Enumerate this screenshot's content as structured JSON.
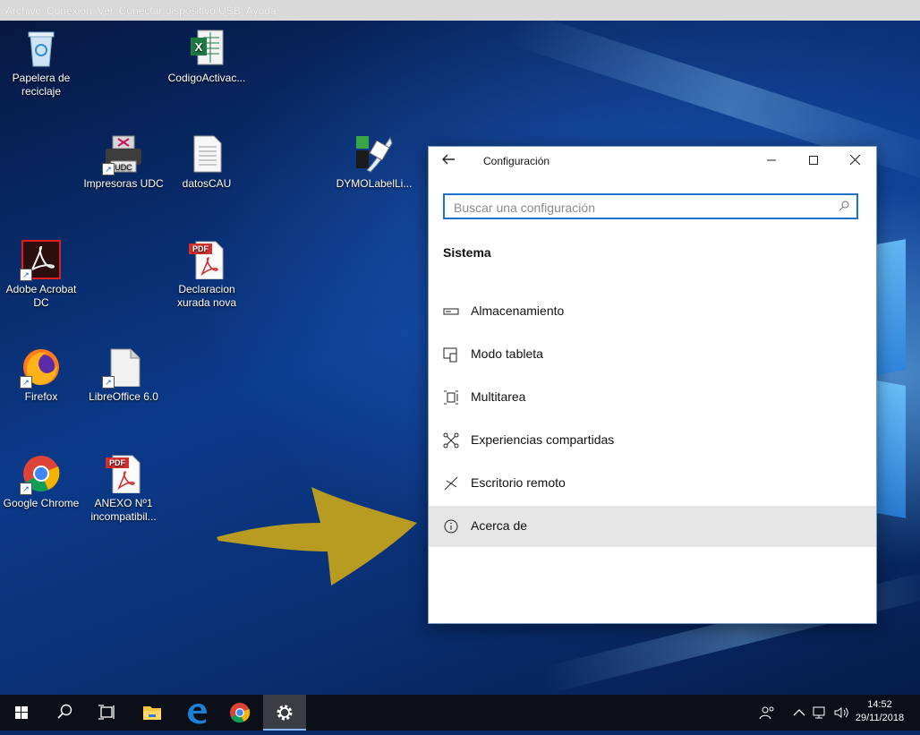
{
  "menubar": {
    "items": [
      "Archivo",
      "Conexión",
      "Ver",
      "Conectar dispositivo USB",
      "Ayuda"
    ]
  },
  "desktop": {
    "icons": [
      {
        "label": "Papelera de reciclaje",
        "icon": "recycle-bin-icon"
      },
      {
        "label": "CodigoActivac...",
        "icon": "excel-file-icon"
      },
      {
        "label": "Impresoras UDC",
        "icon": "printer-icon",
        "badge": "UDC"
      },
      {
        "label": "datosCAU",
        "icon": "text-file-icon"
      },
      {
        "label": "DYMOLabelLi...",
        "icon": "dymo-label-icon"
      },
      {
        "label": "Adobe Acrobat DC",
        "icon": "acrobat-icon"
      },
      {
        "label": "Declaracion xurada nova",
        "icon": "pdf-file-icon",
        "badge": "PDF"
      },
      {
        "label": "Firefox",
        "icon": "firefox-icon"
      },
      {
        "label": "LibreOffice 6.0",
        "icon": "libreoffice-icon"
      },
      {
        "label": "Google Chrome",
        "icon": "chrome-icon"
      },
      {
        "label": "ANEXO Nº1 incompatibil...",
        "icon": "pdf-file-icon",
        "badge": "PDF"
      }
    ]
  },
  "settings": {
    "title": "Configuración",
    "search_placeholder": "Buscar una configuración",
    "section_title": "Sistema",
    "items": [
      {
        "label": "Almacenamiento",
        "icon": "storage-icon"
      },
      {
        "label": "Modo tableta",
        "icon": "tablet-mode-icon"
      },
      {
        "label": "Multitarea",
        "icon": "multitasking-icon"
      },
      {
        "label": "Experiencias compartidas",
        "icon": "shared-experiences-icon"
      },
      {
        "label": "Escritorio remoto",
        "icon": "remote-desktop-icon"
      },
      {
        "label": "Acerca de",
        "icon": "info-icon",
        "selected": true
      }
    ]
  },
  "taskbar": {
    "time": "14:52",
    "date": "29/11/2018"
  },
  "colors": {
    "accent": "#1a72c9",
    "arrow": "#c8a41a",
    "selected_bg": "#e6e6e6"
  }
}
